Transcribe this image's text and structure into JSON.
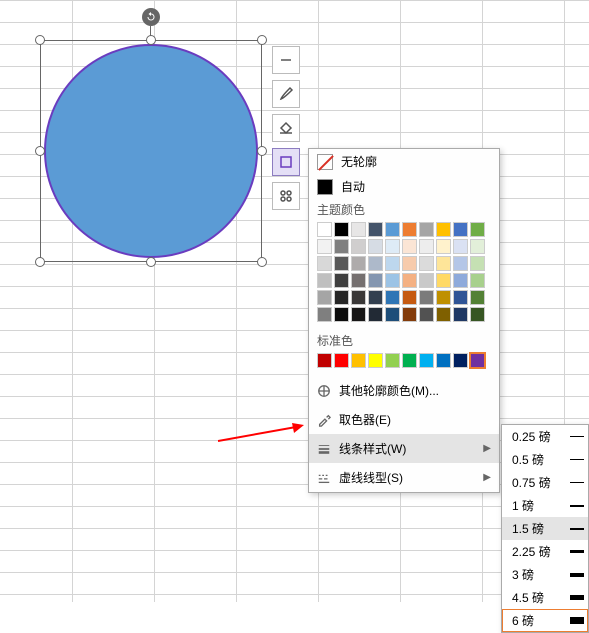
{
  "popup": {
    "no_outline": "无轮廓",
    "auto": "自动",
    "theme_colors_label": "主题颜色",
    "standard_colors_label": "标准色",
    "more_colors": "其他轮廓颜色(M)...",
    "eyedropper": "取色器(E)",
    "line_style": "线条样式(W)",
    "dash_type": "虚线线型(S)"
  },
  "theme_palette": [
    [
      "#ffffff",
      "#000000",
      "#e7e6e6",
      "#44546a",
      "#5b9bd5",
      "#ed7d31",
      "#a5a5a5",
      "#ffc000",
      "#4472c4",
      "#70ad47"
    ],
    [
      "#f2f2f2",
      "#7f7f7f",
      "#d0cece",
      "#d6dce4",
      "#deebf6",
      "#fbe5d5",
      "#ededed",
      "#fff2cc",
      "#dae1f3",
      "#e2efd9"
    ],
    [
      "#d8d8d8",
      "#595959",
      "#aeabab",
      "#adb9ca",
      "#bdd7ee",
      "#f7cbac",
      "#dbdbdb",
      "#fee599",
      "#b4c6e7",
      "#c5e0b3"
    ],
    [
      "#bfbfbf",
      "#3f3f3f",
      "#757070",
      "#8496b0",
      "#9cc3e5",
      "#f4b183",
      "#c9c9c9",
      "#ffd965",
      "#8eaadb",
      "#a8d08d"
    ],
    [
      "#a5a5a5",
      "#262626",
      "#3a3838",
      "#323f4f",
      "#2e75b5",
      "#c55a11",
      "#7b7b7b",
      "#bf9000",
      "#2f5496",
      "#538135"
    ],
    [
      "#7f7f7f",
      "#0c0c0c",
      "#171616",
      "#222a35",
      "#1e4e79",
      "#833c0b",
      "#525252",
      "#7f6000",
      "#1f3864",
      "#375623"
    ]
  ],
  "standard_palette": [
    "#c00000",
    "#ff0000",
    "#ffc000",
    "#ffff00",
    "#92d050",
    "#00b050",
    "#00b0f0",
    "#0070c0",
    "#002060",
    "#7030a0"
  ],
  "standard_selected_index": 9,
  "weights": [
    {
      "label": "0.25 磅",
      "px": 1
    },
    {
      "label": "0.5 磅",
      "px": 1
    },
    {
      "label": "0.75 磅",
      "px": 1
    },
    {
      "label": "1 磅",
      "px": 2
    },
    {
      "label": "1.5 磅",
      "px": 2,
      "highlight": true
    },
    {
      "label": "2.25 磅",
      "px": 3
    },
    {
      "label": "3 磅",
      "px": 4
    },
    {
      "label": "4.5 磅",
      "px": 5
    },
    {
      "label": "6 磅",
      "px": 7,
      "selected": true
    }
  ]
}
